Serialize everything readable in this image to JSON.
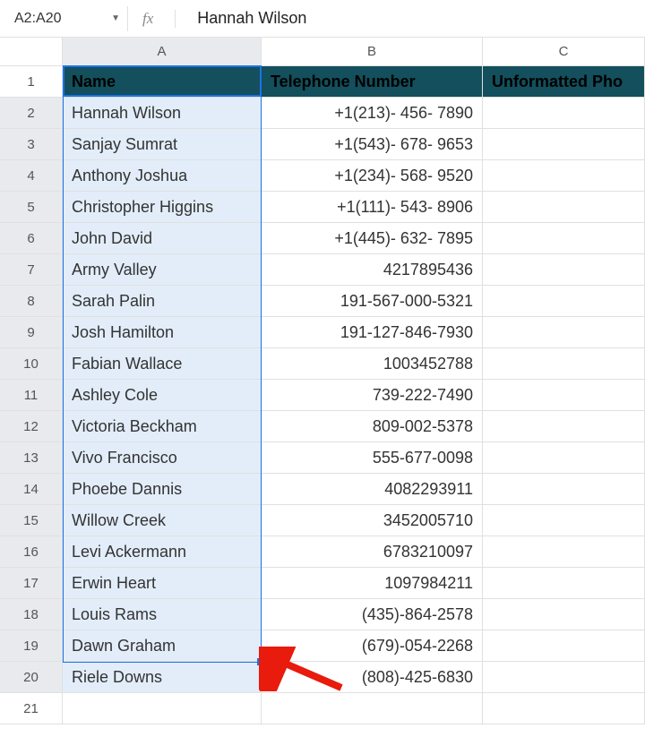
{
  "chart_data": {
    "type": "table",
    "columns": [
      "Name",
      "Telephone Number",
      "Unformatted Phone"
    ],
    "rows": [
      [
        "Hannah Wilson",
        "+1(213)- 456- 7890",
        ""
      ],
      [
        "Sanjay Sumrat",
        "+1(543)- 678- 9653",
        ""
      ],
      [
        "Anthony Joshua",
        "+1(234)- 568- 9520",
        ""
      ],
      [
        "Christopher Higgins",
        "+1(111)- 543- 8906",
        ""
      ],
      [
        "John David",
        "+1(445)- 632- 7895",
        ""
      ],
      [
        "Army Valley",
        "4217895436",
        ""
      ],
      [
        "Sarah Palin",
        "191-567-000-5321",
        ""
      ],
      [
        "Josh Hamilton",
        "191-127-846-7930",
        ""
      ],
      [
        "Fabian Wallace",
        "1003452788",
        ""
      ],
      [
        "Ashley Cole",
        "739-222-7490",
        ""
      ],
      [
        "Victoria Beckham",
        "809-002-5378",
        ""
      ],
      [
        "Vivo Francisco",
        "555-677-0098",
        ""
      ],
      [
        "Phoebe Dannis",
        "4082293911",
        ""
      ],
      [
        "Willow Creek",
        "3452005710",
        ""
      ],
      [
        "Levi Ackermann",
        "6783210097",
        ""
      ],
      [
        "Erwin Heart",
        "1097984211",
        ""
      ],
      [
        "Louis Rams",
        "(435)-864-2578",
        ""
      ],
      [
        "Dawn Graham",
        "(679)-054-2268",
        ""
      ],
      [
        "Riele Downs",
        "(808)-425-6830",
        ""
      ]
    ]
  },
  "nameBox": "A2:A20",
  "formula": "Hannah Wilson",
  "fxLabel": "fx",
  "columns": [
    "A",
    "B",
    "C"
  ],
  "headers": {
    "a": "Name",
    "b": "Telephone Number",
    "c": "Unformatted Pho"
  },
  "rows": [
    {
      "n": "2",
      "a": "Hannah Wilson",
      "b": "+1(213)- 456- 7890"
    },
    {
      "n": "3",
      "a": "Sanjay Sumrat",
      "b": "+1(543)- 678- 9653"
    },
    {
      "n": "4",
      "a": "Anthony Joshua",
      "b": "+1(234)- 568- 9520"
    },
    {
      "n": "5",
      "a": "Christopher Higgins",
      "b": "+1(111)- 543- 8906"
    },
    {
      "n": "6",
      "a": "John David",
      "b": "+1(445)- 632- 7895"
    },
    {
      "n": "7",
      "a": "Army Valley",
      "b": "4217895436"
    },
    {
      "n": "8",
      "a": "Sarah Palin",
      "b": "191-567-000-5321"
    },
    {
      "n": "9",
      "a": "Josh Hamilton",
      "b": "191-127-846-7930"
    },
    {
      "n": "10",
      "a": "Fabian Wallace",
      "b": "1003452788"
    },
    {
      "n": "11",
      "a": "Ashley Cole",
      "b": "739-222-7490"
    },
    {
      "n": "12",
      "a": "Victoria Beckham",
      "b": "809-002-5378"
    },
    {
      "n": "13",
      "a": "Vivo Francisco",
      "b": "555-677-0098"
    },
    {
      "n": "14",
      "a": "Phoebe Dannis",
      "b": "4082293911"
    },
    {
      "n": "15",
      "a": "Willow Creek",
      "b": "3452005710"
    },
    {
      "n": "16",
      "a": "Levi Ackermann",
      "b": "6783210097"
    },
    {
      "n": "17",
      "a": "Erwin Heart",
      "b": "1097984211"
    },
    {
      "n": "18",
      "a": "Louis Rams",
      "b": "(435)-864-2578"
    },
    {
      "n": "19",
      "a": "Dawn Graham",
      "b": "(679)-054-2268"
    },
    {
      "n": "20",
      "a": "Riele Downs",
      "b": "(808)-425-6830"
    }
  ],
  "emptyRow": "21",
  "headerRowNum": "1"
}
